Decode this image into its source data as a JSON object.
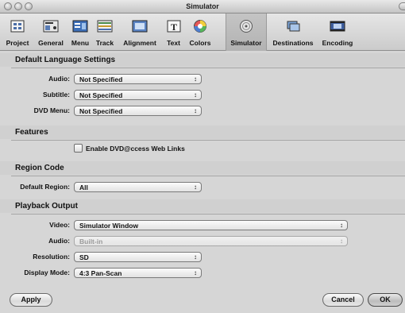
{
  "window": {
    "title": "Simulator"
  },
  "toolbar": {
    "items": [
      {
        "label": "Project",
        "icon": "project-icon"
      },
      {
        "label": "General",
        "icon": "general-icon"
      },
      {
        "label": "Menu",
        "icon": "menu-icon"
      },
      {
        "label": "Track",
        "icon": "track-icon"
      },
      {
        "label": "Alignment",
        "icon": "alignment-icon"
      },
      {
        "label": "Text",
        "icon": "text-icon"
      },
      {
        "label": "Colors",
        "icon": "colors-icon"
      },
      {
        "label": "Simulator",
        "icon": "simulator-icon",
        "selected": true
      },
      {
        "label": "Destinations",
        "icon": "destinations-icon"
      },
      {
        "label": "Encoding",
        "icon": "encoding-icon"
      }
    ]
  },
  "language": {
    "heading": "Default Language Settings",
    "audio_label": "Audio:",
    "audio_value": "Not Specified",
    "subtitle_label": "Subtitle:",
    "subtitle_value": "Not Specified",
    "dvdmenu_label": "DVD Menu:",
    "dvdmenu_value": "Not Specified"
  },
  "features": {
    "heading": "Features",
    "dvd_access_label": "Enable DVD@ccess Web Links",
    "dvd_access_checked": false
  },
  "region": {
    "heading": "Region Code",
    "default_region_label": "Default Region:",
    "default_region_value": "All"
  },
  "playback": {
    "heading": "Playback Output",
    "video_label": "Video:",
    "video_value": "Simulator Window",
    "audio_label": "Audio:",
    "audio_value": "Built-in",
    "resolution_label": "Resolution:",
    "resolution_value": "SD",
    "display_mode_label": "Display Mode:",
    "display_mode_value": "4:3 Pan-Scan"
  },
  "buttons": {
    "apply": "Apply",
    "cancel": "Cancel",
    "ok": "OK"
  },
  "colors": {
    "background": "#d6d6d6",
    "selected_tab": "#b8b8b8"
  }
}
